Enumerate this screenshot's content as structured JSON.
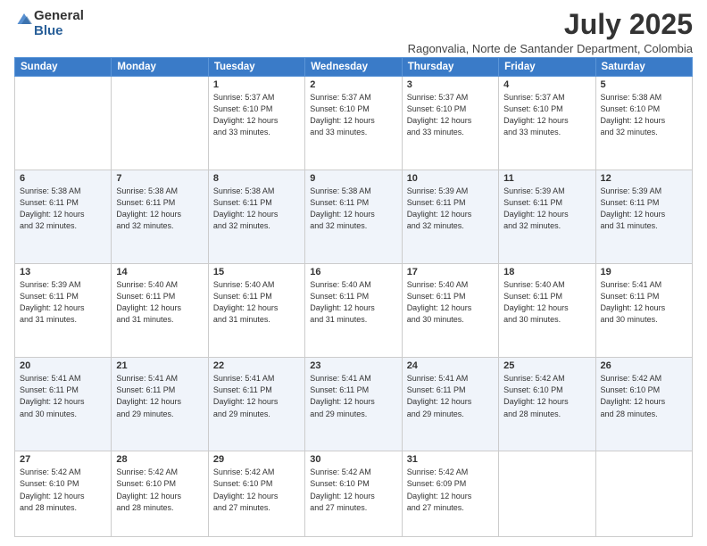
{
  "logo": {
    "general": "General",
    "blue": "Blue"
  },
  "title": "July 2025",
  "subtitle": "Ragonvalia, Norte de Santander Department, Colombia",
  "days_of_week": [
    "Sunday",
    "Monday",
    "Tuesday",
    "Wednesday",
    "Thursday",
    "Friday",
    "Saturday"
  ],
  "weeks": [
    [
      {
        "day": null
      },
      {
        "day": null
      },
      {
        "day": "1",
        "info": "Sunrise: 5:37 AM\nSunset: 6:10 PM\nDaylight: 12 hours\nand 33 minutes."
      },
      {
        "day": "2",
        "info": "Sunrise: 5:37 AM\nSunset: 6:10 PM\nDaylight: 12 hours\nand 33 minutes."
      },
      {
        "day": "3",
        "info": "Sunrise: 5:37 AM\nSunset: 6:10 PM\nDaylight: 12 hours\nand 33 minutes."
      },
      {
        "day": "4",
        "info": "Sunrise: 5:37 AM\nSunset: 6:10 PM\nDaylight: 12 hours\nand 33 minutes."
      },
      {
        "day": "5",
        "info": "Sunrise: 5:38 AM\nSunset: 6:10 PM\nDaylight: 12 hours\nand 32 minutes."
      }
    ],
    [
      {
        "day": "6",
        "info": "Sunrise: 5:38 AM\nSunset: 6:11 PM\nDaylight: 12 hours\nand 32 minutes."
      },
      {
        "day": "7",
        "info": "Sunrise: 5:38 AM\nSunset: 6:11 PM\nDaylight: 12 hours\nand 32 minutes."
      },
      {
        "day": "8",
        "info": "Sunrise: 5:38 AM\nSunset: 6:11 PM\nDaylight: 12 hours\nand 32 minutes."
      },
      {
        "day": "9",
        "info": "Sunrise: 5:38 AM\nSunset: 6:11 PM\nDaylight: 12 hours\nand 32 minutes."
      },
      {
        "day": "10",
        "info": "Sunrise: 5:39 AM\nSunset: 6:11 PM\nDaylight: 12 hours\nand 32 minutes."
      },
      {
        "day": "11",
        "info": "Sunrise: 5:39 AM\nSunset: 6:11 PM\nDaylight: 12 hours\nand 32 minutes."
      },
      {
        "day": "12",
        "info": "Sunrise: 5:39 AM\nSunset: 6:11 PM\nDaylight: 12 hours\nand 31 minutes."
      }
    ],
    [
      {
        "day": "13",
        "info": "Sunrise: 5:39 AM\nSunset: 6:11 PM\nDaylight: 12 hours\nand 31 minutes."
      },
      {
        "day": "14",
        "info": "Sunrise: 5:40 AM\nSunset: 6:11 PM\nDaylight: 12 hours\nand 31 minutes."
      },
      {
        "day": "15",
        "info": "Sunrise: 5:40 AM\nSunset: 6:11 PM\nDaylight: 12 hours\nand 31 minutes."
      },
      {
        "day": "16",
        "info": "Sunrise: 5:40 AM\nSunset: 6:11 PM\nDaylight: 12 hours\nand 31 minutes."
      },
      {
        "day": "17",
        "info": "Sunrise: 5:40 AM\nSunset: 6:11 PM\nDaylight: 12 hours\nand 30 minutes."
      },
      {
        "day": "18",
        "info": "Sunrise: 5:40 AM\nSunset: 6:11 PM\nDaylight: 12 hours\nand 30 minutes."
      },
      {
        "day": "19",
        "info": "Sunrise: 5:41 AM\nSunset: 6:11 PM\nDaylight: 12 hours\nand 30 minutes."
      }
    ],
    [
      {
        "day": "20",
        "info": "Sunrise: 5:41 AM\nSunset: 6:11 PM\nDaylight: 12 hours\nand 30 minutes."
      },
      {
        "day": "21",
        "info": "Sunrise: 5:41 AM\nSunset: 6:11 PM\nDaylight: 12 hours\nand 29 minutes."
      },
      {
        "day": "22",
        "info": "Sunrise: 5:41 AM\nSunset: 6:11 PM\nDaylight: 12 hours\nand 29 minutes."
      },
      {
        "day": "23",
        "info": "Sunrise: 5:41 AM\nSunset: 6:11 PM\nDaylight: 12 hours\nand 29 minutes."
      },
      {
        "day": "24",
        "info": "Sunrise: 5:41 AM\nSunset: 6:11 PM\nDaylight: 12 hours\nand 29 minutes."
      },
      {
        "day": "25",
        "info": "Sunrise: 5:42 AM\nSunset: 6:10 PM\nDaylight: 12 hours\nand 28 minutes."
      },
      {
        "day": "26",
        "info": "Sunrise: 5:42 AM\nSunset: 6:10 PM\nDaylight: 12 hours\nand 28 minutes."
      }
    ],
    [
      {
        "day": "27",
        "info": "Sunrise: 5:42 AM\nSunset: 6:10 PM\nDaylight: 12 hours\nand 28 minutes."
      },
      {
        "day": "28",
        "info": "Sunrise: 5:42 AM\nSunset: 6:10 PM\nDaylight: 12 hours\nand 28 minutes."
      },
      {
        "day": "29",
        "info": "Sunrise: 5:42 AM\nSunset: 6:10 PM\nDaylight: 12 hours\nand 27 minutes."
      },
      {
        "day": "30",
        "info": "Sunrise: 5:42 AM\nSunset: 6:10 PM\nDaylight: 12 hours\nand 27 minutes."
      },
      {
        "day": "31",
        "info": "Sunrise: 5:42 AM\nSunset: 6:09 PM\nDaylight: 12 hours\nand 27 minutes."
      },
      {
        "day": null
      },
      {
        "day": null
      }
    ]
  ]
}
